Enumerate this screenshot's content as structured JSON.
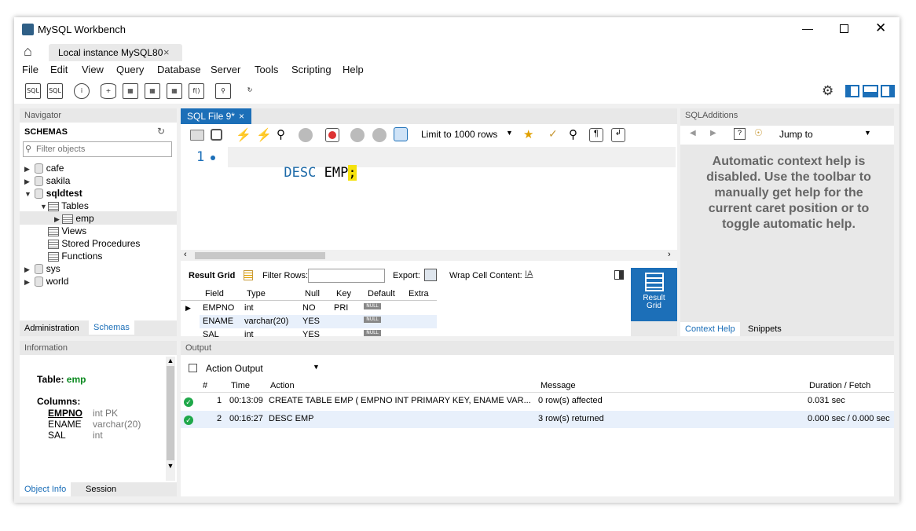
{
  "window": {
    "title": "MySQL Workbench"
  },
  "connection_tab": {
    "label": "Local instance MySQL80",
    "close": "×"
  },
  "menu": [
    "File",
    "Edit",
    "View",
    "Query",
    "Database",
    "Server",
    "Tools",
    "Scripting",
    "Help"
  ],
  "navigator": {
    "title": "Navigator",
    "schemas_label": "SCHEMAS",
    "filter_placeholder": "Filter objects",
    "schemas": [
      "cafe",
      "sakila",
      "sqldtest",
      "sys",
      "world"
    ],
    "tables_label": "Tables",
    "table": "emp",
    "views_label": "Views",
    "procs_label": "Stored Procedures",
    "funcs_label": "Functions",
    "tabs": [
      "Administration",
      "Schemas"
    ]
  },
  "information": {
    "title": "Information",
    "table_label": "Table:",
    "table_name": "emp",
    "columns_label": "Columns:",
    "columns": [
      {
        "name": "EMPNO",
        "type": "int PK"
      },
      {
        "name": "ENAME",
        "type": "varchar(20)"
      },
      {
        "name": "SAL",
        "type": "int"
      }
    ],
    "tabs": [
      "Object Info",
      "Session"
    ]
  },
  "editor": {
    "tab_label": "SQL File 9*",
    "tab_close": "×",
    "limit_label": "Limit to 1000 rows",
    "line_number": "1",
    "keyword": "DESC",
    "identifier": "EMP",
    "semicolon": ";"
  },
  "result": {
    "grid_label": "Result Grid",
    "filter_label": "Filter Rows:",
    "export_label": "Export:",
    "wrap_label": "Wrap Cell Content:",
    "side_label": "Result Grid",
    "columns": [
      "Field",
      "Type",
      "Null",
      "Key",
      "Default",
      "Extra"
    ],
    "rows": [
      [
        "EMPNO",
        "int",
        "NO",
        "PRI",
        "NULL",
        ""
      ],
      [
        "ENAME",
        "varchar(20)",
        "YES",
        "",
        "NULL",
        ""
      ],
      [
        "SAL",
        "int",
        "YES",
        "",
        "NULL",
        ""
      ]
    ]
  },
  "sql_additions": {
    "title": "SQLAdditions",
    "jump_label": "Jump to",
    "help_text": "Automatic context help is disabled. Use the toolbar to manually get help for the current caret position or to toggle automatic help.",
    "tabs": [
      "Context Help",
      "Snippets"
    ]
  },
  "output": {
    "title": "Output",
    "selector": "Action Output",
    "columns": [
      "#",
      "Time",
      "Action",
      "Message",
      "Duration / Fetch"
    ],
    "rows": [
      {
        "n": "1",
        "time": "00:13:09",
        "action": "CREATE TABLE EMP ( EMPNO INT PRIMARY KEY, ENAME VAR...",
        "message": "0 row(s) affected",
        "duration": "0.031 sec"
      },
      {
        "n": "2",
        "time": "00:16:27",
        "action": "DESC EMP",
        "message": "3 row(s) returned",
        "duration": "0.000 sec / 0.000 sec"
      }
    ]
  },
  "colors": {
    "accent": "#1c6fb8",
    "keyword": "#1d6aa8",
    "ok": "#1fa84a"
  }
}
